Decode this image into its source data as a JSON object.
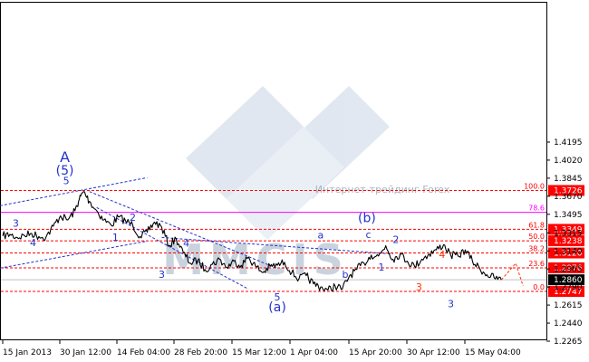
{
  "chart_data": {
    "type": "line",
    "watermark": {
      "text": "MMCIS",
      "subtext": "Интернет-трейдинг   Forex"
    },
    "x_ticks": [
      "15 Jan 2013",
      "30 Jan 12:00",
      "14 Feb 04:00",
      "28 Feb 20:00",
      "15 Mar 12:00",
      "1 Apr 04:00",
      "15 Apr 20:00",
      "30 Apr 12:00",
      "15 May 04:00"
    ],
    "y_ticks": [
      "1.4195",
      "1.4020",
      "1.3845",
      "1.3670",
      "1.3495",
      "1.3315",
      "1.3140",
      "1.2965",
      "1.2790",
      "1.2615",
      "1.2440",
      "1.2265"
    ],
    "ylim": [
      1.2265,
      1.4195
    ],
    "price_marker": {
      "label": "1.2860",
      "value": 1.286
    },
    "levels": [
      {
        "label": "1.3726",
        "value": 1.3726,
        "fib": "100.0",
        "color": "#ff0000",
        "dash": true
      },
      {
        "label": "",
        "value": 1.3514,
        "fib": "78.6",
        "color": "#ff00ff",
        "dash": false
      },
      {
        "label": "1.3349",
        "value": 1.3349,
        "fib": "61.8",
        "color": "#ff0000",
        "dash": true
      },
      {
        "label": "1.3238",
        "value": 1.3238,
        "fib": "50.0",
        "color": "#ff0000",
        "dash": true
      },
      {
        "label": "1.3120",
        "value": 1.312,
        "fib": "38.2",
        "color": "#ff0000",
        "dash": true
      },
      {
        "label": "1.2976",
        "value": 1.2976,
        "fib": "23.6",
        "color": "#ff0000",
        "dash": true
      },
      {
        "label": "1.2747",
        "value": 1.2747,
        "fib": "0.0",
        "color": "#ff0000",
        "dash": true
      }
    ],
    "price_series": [
      {
        "x": 0.0,
        "y": 1.3285
      },
      {
        "x": 0.5,
        "y": 1.33
      },
      {
        "x": 1.0,
        "y": 1.327
      },
      {
        "x": 1.5,
        "y": 1.329
      },
      {
        "x": 2.0,
        "y": 1.331
      },
      {
        "x": 2.5,
        "y": 1.328
      },
      {
        "x": 3.0,
        "y": 1.3275
      },
      {
        "x": 3.5,
        "y": 1.338
      },
      {
        "x": 4.0,
        "y": 1.348
      },
      {
        "x": 4.5,
        "y": 1.344
      },
      {
        "x": 5.0,
        "y": 1.353
      },
      {
        "x": 5.3,
        "y": 1.364
      },
      {
        "x": 5.6,
        "y": 1.3715
      },
      {
        "x": 6.0,
        "y": 1.362
      },
      {
        "x": 6.5,
        "y": 1.353
      },
      {
        "x": 7.0,
        "y": 1.344
      },
      {
        "x": 7.5,
        "y": 1.339
      },
      {
        "x": 8.0,
        "y": 1.347
      },
      {
        "x": 8.5,
        "y": 1.343
      },
      {
        "x": 9.0,
        "y": 1.339
      },
      {
        "x": 9.5,
        "y": 1.328
      },
      {
        "x": 10.0,
        "y": 1.332
      },
      {
        "x": 10.5,
        "y": 1.342
      },
      {
        "x": 11.0,
        "y": 1.337
      },
      {
        "x": 11.5,
        "y": 1.319
      },
      {
        "x": 12.0,
        "y": 1.326
      },
      {
        "x": 12.5,
        "y": 1.312
      },
      {
        "x": 13.0,
        "y": 1.302
      },
      {
        "x": 13.5,
        "y": 1.305
      },
      {
        "x": 14.0,
        "y": 1.296
      },
      {
        "x": 14.5,
        "y": 1.301
      },
      {
        "x": 15.0,
        "y": 1.306
      },
      {
        "x": 15.5,
        "y": 1.298
      },
      {
        "x": 16.0,
        "y": 1.304
      },
      {
        "x": 16.5,
        "y": 1.3
      },
      {
        "x": 17.0,
        "y": 1.308
      },
      {
        "x": 17.5,
        "y": 1.299
      },
      {
        "x": 18.0,
        "y": 1.293
      },
      {
        "x": 18.5,
        "y": 1.299
      },
      {
        "x": 19.0,
        "y": 1.3
      },
      {
        "x": 19.5,
        "y": 1.303
      },
      {
        "x": 20.0,
        "y": 1.293
      },
      {
        "x": 20.5,
        "y": 1.287
      },
      {
        "x": 21.0,
        "y": 1.29
      },
      {
        "x": 21.5,
        "y": 1.282
      },
      {
        "x": 22.0,
        "y": 1.279
      },
      {
        "x": 22.5,
        "y": 1.276
      },
      {
        "x": 23.0,
        "y": 1.28
      },
      {
        "x": 23.5,
        "y": 1.277
      },
      {
        "x": 24.0,
        "y": 1.29
      },
      {
        "x": 24.5,
        "y": 1.296
      },
      {
        "x": 25.0,
        "y": 1.302
      },
      {
        "x": 25.5,
        "y": 1.31
      },
      {
        "x": 26.0,
        "y": 1.309
      },
      {
        "x": 26.5,
        "y": 1.319
      },
      {
        "x": 27.0,
        "y": 1.306
      },
      {
        "x": 27.5,
        "y": 1.311
      },
      {
        "x": 28.0,
        "y": 1.304
      },
      {
        "x": 28.5,
        "y": 1.299
      },
      {
        "x": 29.0,
        "y": 1.306
      },
      {
        "x": 29.5,
        "y": 1.311
      },
      {
        "x": 30.0,
        "y": 1.315
      },
      {
        "x": 30.5,
        "y": 1.32
      },
      {
        "x": 31.0,
        "y": 1.31
      },
      {
        "x": 31.5,
        "y": 1.309
      },
      {
        "x": 32.0,
        "y": 1.315
      },
      {
        "x": 32.5,
        "y": 1.304
      },
      {
        "x": 33.0,
        "y": 1.297
      },
      {
        "x": 33.5,
        "y": 1.291
      },
      {
        "x": 34.0,
        "y": 1.288
      },
      {
        "x": 34.5,
        "y": 1.286
      }
    ],
    "channels": [
      {
        "points": [
          {
            "x": -0.5,
            "y": 1.357
          },
          {
            "x": 10.0,
            "y": 1.385
          }
        ]
      },
      {
        "points": [
          {
            "x": -0.5,
            "y": 1.2965
          },
          {
            "x": 10.0,
            "y": 1.3235
          }
        ]
      },
      {
        "points": [
          {
            "x": 6.0,
            "y": 1.3715
          },
          {
            "x": 19.0,
            "y": 1.297
          }
        ]
      },
      {
        "points": [
          {
            "x": 6.5,
            "y": 1.356
          },
          {
            "x": 17.0,
            "y": 1.277
          }
        ]
      },
      {
        "points": [
          {
            "x": 11.0,
            "y": 1.327
          },
          {
            "x": 27.0,
            "y": 1.311
          }
        ]
      }
    ],
    "projection": [
      {
        "x": 34.5,
        "y": 1.286
      },
      {
        "x": 35.5,
        "y": 1.302
      },
      {
        "x": 36.0,
        "y": 1.28
      }
    ],
    "wave_labels": [
      {
        "text": "A",
        "x": 4.3,
        "y": 1.4,
        "color": "#2233cc",
        "size": 16
      },
      {
        "text": "(5)",
        "x": 4.3,
        "y": 1.388,
        "color": "#2233cc",
        "size": 14
      },
      {
        "text": "5",
        "x": 4.4,
        "y": 1.3785,
        "color": "#2233cc",
        "size": 11
      },
      {
        "text": "3",
        "x": 0.9,
        "y": 1.3375,
        "color": "#2233cc",
        "size": 11
      },
      {
        "text": "4",
        "x": 2.1,
        "y": 1.3185,
        "color": "#2233cc",
        "size": 11
      },
      {
        "text": "2",
        "x": 9.0,
        "y": 1.343,
        "color": "#2233cc",
        "size": 11
      },
      {
        "text": "1",
        "x": 7.8,
        "y": 1.324,
        "color": "#2233cc",
        "size": 11
      },
      {
        "text": "4",
        "x": 12.7,
        "y": 1.318,
        "color": "#2233cc",
        "size": 11
      },
      {
        "text": "3",
        "x": 11.0,
        "y": 1.288,
        "color": "#2233cc",
        "size": 11
      },
      {
        "text": "5",
        "x": 19.0,
        "y": 1.266,
        "color": "#2233cc",
        "size": 11
      },
      {
        "text": "(a)",
        "x": 19.0,
        "y": 1.2555,
        "color": "#2233cc",
        "size": 14
      },
      {
        "text": "(b)",
        "x": 25.2,
        "y": 1.342,
        "color": "#2233cc",
        "size": 14
      },
      {
        "text": "a",
        "x": 22.0,
        "y": 1.326,
        "color": "#2233cc",
        "size": 11
      },
      {
        "text": "b",
        "x": 23.7,
        "y": 1.288,
        "color": "#2233cc",
        "size": 11
      },
      {
        "text": "c",
        "x": 25.3,
        "y": 1.3265,
        "color": "#2233cc",
        "size": 11
      },
      {
        "text": "2",
        "x": 27.2,
        "y": 1.3215,
        "color": "#2233cc",
        "size": 11
      },
      {
        "text": "1",
        "x": 26.2,
        "y": 1.295,
        "color": "#2233cc",
        "size": 11
      },
      {
        "text": "3",
        "x": 31.0,
        "y": 1.2595,
        "color": "#2233cc",
        "size": 11
      },
      {
        "text": "4",
        "x": 30.4,
        "y": 1.307,
        "color": "#ff3300",
        "size": 11
      },
      {
        "text": "3",
        "x": 28.8,
        "y": 1.2755,
        "color": "#ff3300",
        "size": 11
      }
    ]
  }
}
